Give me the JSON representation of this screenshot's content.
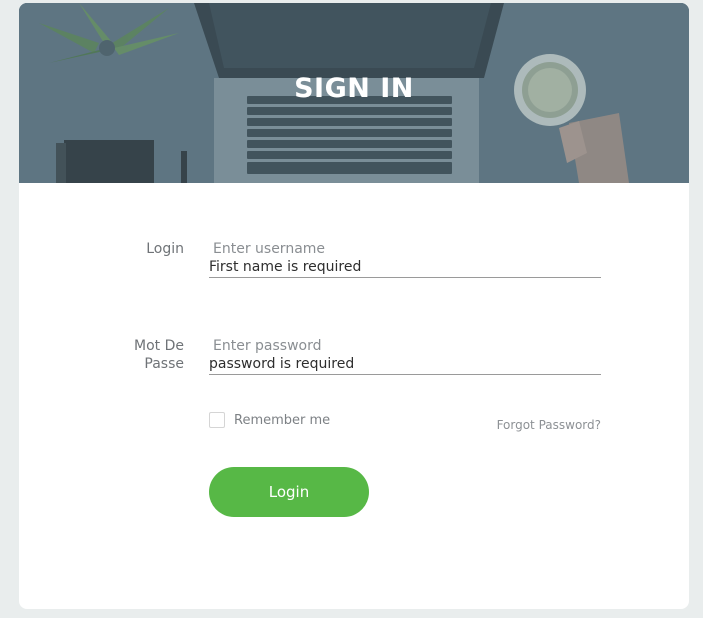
{
  "header": {
    "title": "SIGN IN"
  },
  "form": {
    "login_label": "Login",
    "username_placeholder": "Enter username",
    "username_error": "First name is required",
    "password_label_line1": "Mot De",
    "password_label_line2": "Passe",
    "password_placeholder": "Enter password",
    "password_error": "password is required",
    "remember_label": "Remember me",
    "forgot_link": "Forgot Password?",
    "submit_label": "Login"
  },
  "colors": {
    "accent": "#57b846",
    "page_background": "#e9eded",
    "hero_overlay": "#5d7380"
  }
}
